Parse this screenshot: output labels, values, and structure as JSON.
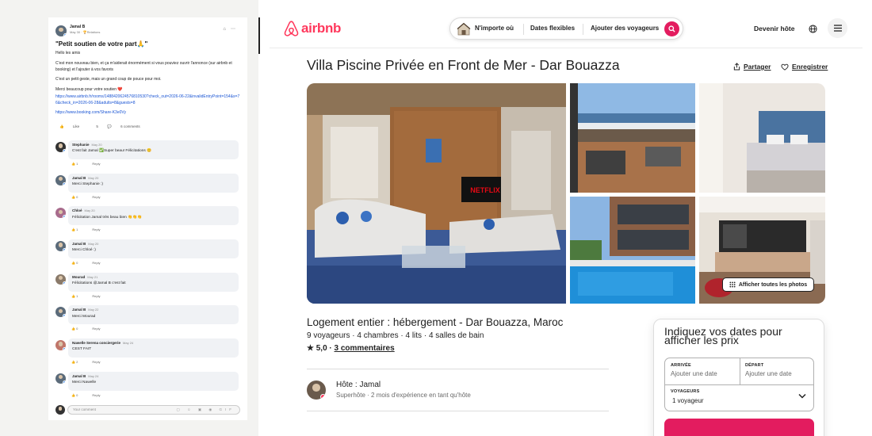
{
  "fb_post": {
    "author": "Jamal B",
    "meta": "May 30 · 🏆Relations",
    "title": "\"Petit soutien de votre part🙏\"",
    "greeting": "Hello les amis",
    "para1": "C'est mon nouveau bien, et ça m'aiderait énormément si vous pouviez ouvrir l'annonce (sur airbnb et booking) et l'ajouter à vos favoris",
    "para2": "C'est un petit geste, mais un grand coup de pouce pour moi.",
    "para3": "Merci beaucoup pour votre soutien ❤️",
    "link1": "https://www.airbnb.fr/rooms/1488420624576810530?check_out=2026-06-22&invalidEntryPoint=154&s=76&check_in=2026-06-28&adults=8&guests=8",
    "link2": "https://www.booking.com/Share-K3e0Vy",
    "like_label": "Like",
    "like_count": "5",
    "comments_label": "6 comments",
    "reply_placeholder": "Your comment",
    "reply_icons": "▢ ☺ ▣ ◉ GIF"
  },
  "comments": [
    {
      "name": "Stephanie",
      "date": "May 20",
      "text": "C'est fait Jamal ✅Super beau! Félicitations 😊",
      "count": "1",
      "reply": "Reply"
    },
    {
      "name": "Jamal B",
      "date": "May 20",
      "text": "Merci Stephanie :)",
      "count": "0",
      "reply": "Reply"
    },
    {
      "name": "Chloé",
      "date": "May 20",
      "text": "Félicitation Jamal très beau bien 👏👏👏",
      "count": "1",
      "reply": "Reply"
    },
    {
      "name": "Jamal B",
      "date": "May 20",
      "text": "Merci Chloé :)",
      "count": "0",
      "reply": "Reply"
    },
    {
      "name": "Mourad",
      "date": "May 21",
      "text": "Félicitations @Jamal B c'est fait",
      "count": "1",
      "reply": "Reply"
    },
    {
      "name": "Jamal B",
      "date": "May 22",
      "text": "Merci Mourad",
      "count": "0",
      "reply": "Reply"
    },
    {
      "name": "Nawelle Serena conciergerie",
      "date": "May 24",
      "text": "CEST FAIT",
      "count": "2",
      "reply": "Reply"
    },
    {
      "name": "Jamal B",
      "date": "May 24",
      "text": "Merci Nawelle",
      "count": "0",
      "reply": "Reply"
    }
  ],
  "airbnb": {
    "logo_text": "airbnb",
    "search": {
      "where": "N'importe où",
      "when": "Dates flexibles",
      "who": "Ajouter des voyageurs"
    },
    "host_link": "Devenir hôte",
    "title": "Villa Piscine Privée en Front de Mer - Dar Bouazza",
    "share": "Partager",
    "save": "Enregistrer",
    "show_all_photos": "Afficher toutes les photos",
    "tv_brand": "NETFLIX",
    "subtitle": "Logement entier : hébergement - Dar Bouazza, Maroc",
    "details": "9 voyageurs · 4 chambres · 4 lits · 4 salles de bain",
    "rating_star": "★ 5,0 · ",
    "reviews": "3 commentaires",
    "host_title": "Hôte : Jamal",
    "host_sub": "Superhôte · 2 mois d'expérience en tant qu'hôte",
    "booking": {
      "title": "Indiquez vos dates pour afficher les prix",
      "arrival_label": "ARRIVÉE",
      "arrival_value": "Ajouter une date",
      "departure_label": "DÉPART",
      "departure_value": "Ajouter une date",
      "guests_label": "VOYAGEURS",
      "guests_value": "1 voyageur"
    },
    "colors": {
      "brand": "#ff385c",
      "cta": "#e31c5f"
    }
  }
}
